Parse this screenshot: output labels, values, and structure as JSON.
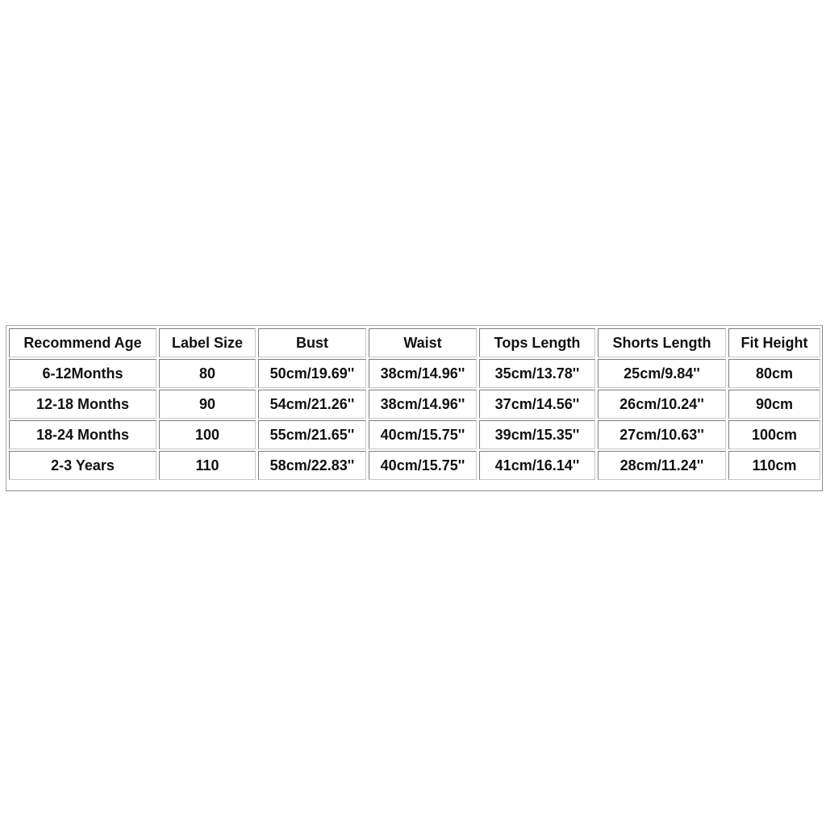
{
  "size_chart": {
    "headers": [
      "Recommend Age",
      "Label Size",
      "Bust",
      "Waist",
      "Tops Length",
      "Shorts Length",
      "Fit Height"
    ],
    "rows": [
      [
        "6-12Months",
        "80",
        "50cm/19.69''",
        "38cm/14.96''",
        "35cm/13.78''",
        "25cm/9.84''",
        "80cm"
      ],
      [
        "12-18 Months",
        "90",
        "54cm/21.26''",
        "38cm/14.96''",
        "37cm/14.56''",
        "26cm/10.24''",
        "90cm"
      ],
      [
        "18-24 Months",
        "100",
        "55cm/21.65''",
        "40cm/15.75''",
        "39cm/15.35''",
        "27cm/10.63''",
        "100cm"
      ],
      [
        "2-3 Years",
        "110",
        "58cm/22.83''",
        "40cm/15.75''",
        "41cm/16.14''",
        "28cm/11.24''",
        "110cm"
      ]
    ]
  }
}
